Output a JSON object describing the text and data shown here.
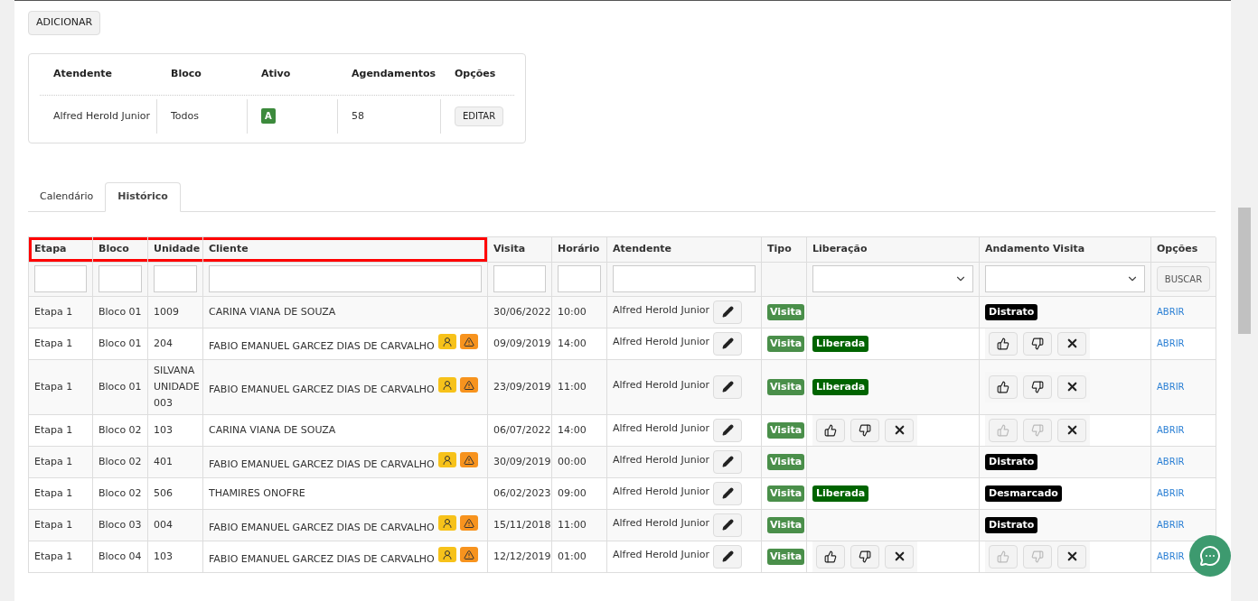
{
  "add_button": "ADICIONAR",
  "summary": {
    "columns": [
      "Atendente",
      "Bloco",
      "Ativo",
      "Agendamentos",
      "Opções"
    ],
    "row": {
      "atendente": "Alfred Herold Junior",
      "bloco": "Todos",
      "ativo": "A",
      "agendamentos": "58",
      "action": "EDITAR"
    }
  },
  "tabs": [
    {
      "label": "Calendário",
      "selected": false
    },
    {
      "label": "Histórico",
      "selected": true
    }
  ],
  "table": {
    "columns": [
      {
        "label": "Etapa",
        "highlighted": true
      },
      {
        "label": "Bloco",
        "highlighted": true
      },
      {
        "label": "Unidade",
        "highlighted": true
      },
      {
        "label": "Cliente",
        "highlighted": true
      },
      {
        "label": "Visita",
        "highlighted": false
      },
      {
        "label": "Horário",
        "highlighted": false
      },
      {
        "label": "Atendente",
        "highlighted": false
      },
      {
        "label": "Tipo",
        "highlighted": false
      },
      {
        "label": "Liberação",
        "highlighted": false
      },
      {
        "label": "Andamento Visita",
        "highlighted": false
      },
      {
        "label": "Opções",
        "highlighted": false
      }
    ],
    "filters": [
      {
        "kind": "text"
      },
      {
        "kind": "text"
      },
      {
        "kind": "text"
      },
      {
        "kind": "text"
      },
      {
        "kind": "text"
      },
      {
        "kind": "text"
      },
      {
        "kind": "text"
      },
      {
        "kind": "none"
      },
      {
        "kind": "select"
      },
      {
        "kind": "select"
      },
      {
        "kind": "button",
        "label": "BUSCAR"
      }
    ],
    "rows": [
      {
        "etapa": "Etapa 1",
        "bloco": "Bloco 01",
        "unidade": "1009",
        "cliente": "CARINA VIANA DE SOUZA",
        "alerts": false,
        "visita": "30/06/2022",
        "horario": "10:00",
        "atendente": "Alfred Herold Junior",
        "tipo": "Visita",
        "liberacao": {
          "kind": "empty"
        },
        "andamento": {
          "kind": "badge",
          "label": "Distrato"
        },
        "action": "ABRIR"
      },
      {
        "etapa": "Etapa 1",
        "bloco": "Bloco 01",
        "unidade": "204",
        "cliente": "FABIO EMANUEL GARCEZ DIAS DE CARVALHO",
        "alerts": true,
        "visita": "09/09/2019",
        "horario": "14:00",
        "atendente": "Alfred Herold Junior",
        "tipo": "Visita",
        "liberacao": {
          "kind": "badge",
          "label": "Liberada"
        },
        "andamento": {
          "kind": "actions",
          "thumbs_disabled": false
        },
        "action": "ABRIR"
      },
      {
        "etapa": "Etapa 1",
        "bloco": "Bloco 01",
        "unidade": "SILVANA UNIDADE 003",
        "cliente": "FABIO EMANUEL GARCEZ DIAS DE CARVALHO",
        "alerts": true,
        "visita": "23/09/2019",
        "horario": "11:00",
        "atendente": "Alfred Herold Junior",
        "tipo": "Visita",
        "liberacao": {
          "kind": "badge",
          "label": "Liberada"
        },
        "andamento": {
          "kind": "actions",
          "thumbs_disabled": false
        },
        "action": "ABRIR"
      },
      {
        "etapa": "Etapa 1",
        "bloco": "Bloco 02",
        "unidade": "103",
        "cliente": "CARINA VIANA DE SOUZA",
        "alerts": false,
        "visita": "06/07/2022",
        "horario": "14:00",
        "atendente": "Alfred Herold Junior",
        "tipo": "Visita",
        "liberacao": {
          "kind": "actions",
          "thumbs_disabled": false
        },
        "andamento": {
          "kind": "actions",
          "thumbs_disabled": true
        },
        "action": "ABRIR"
      },
      {
        "etapa": "Etapa 1",
        "bloco": "Bloco 02",
        "unidade": "401",
        "cliente": "FABIO EMANUEL GARCEZ DIAS DE CARVALHO",
        "alerts": true,
        "visita": "30/09/2019",
        "horario": "00:00",
        "atendente": "Alfred Herold Junior",
        "tipo": "Visita",
        "liberacao": {
          "kind": "empty"
        },
        "andamento": {
          "kind": "badge",
          "label": "Distrato"
        },
        "action": "ABRIR"
      },
      {
        "etapa": "Etapa 1",
        "bloco": "Bloco 02",
        "unidade": "506",
        "cliente": "THAMIRES ONOFRE",
        "alerts": false,
        "visita": "06/02/2023",
        "horario": "09:00",
        "atendente": "Alfred Herold Junior",
        "tipo": "Visita",
        "liberacao": {
          "kind": "badge",
          "label": "Liberada"
        },
        "andamento": {
          "kind": "badge",
          "label": "Desmarcado"
        },
        "action": "ABRIR"
      },
      {
        "etapa": "Etapa 1",
        "bloco": "Bloco 03",
        "unidade": "004",
        "cliente": "FABIO EMANUEL GARCEZ DIAS DE CARVALHO",
        "alerts": true,
        "visita": "15/11/2018",
        "horario": "11:00",
        "atendente": "Alfred Herold Junior",
        "tipo": "Visita",
        "liberacao": {
          "kind": "empty"
        },
        "andamento": {
          "kind": "badge",
          "label": "Distrato"
        },
        "action": "ABRIR"
      },
      {
        "etapa": "Etapa 1",
        "bloco": "Bloco 04",
        "unidade": "103",
        "cliente": "FABIO EMANUEL GARCEZ DIAS DE CARVALHO",
        "alerts": true,
        "visita": "12/12/2019",
        "horario": "01:00",
        "atendente": "Alfred Herold Junior",
        "tipo": "Visita",
        "liberacao": {
          "kind": "actions",
          "thumbs_disabled": false
        },
        "andamento": {
          "kind": "actions",
          "thumbs_disabled": true
        },
        "action": "ABRIR"
      }
    ]
  }
}
